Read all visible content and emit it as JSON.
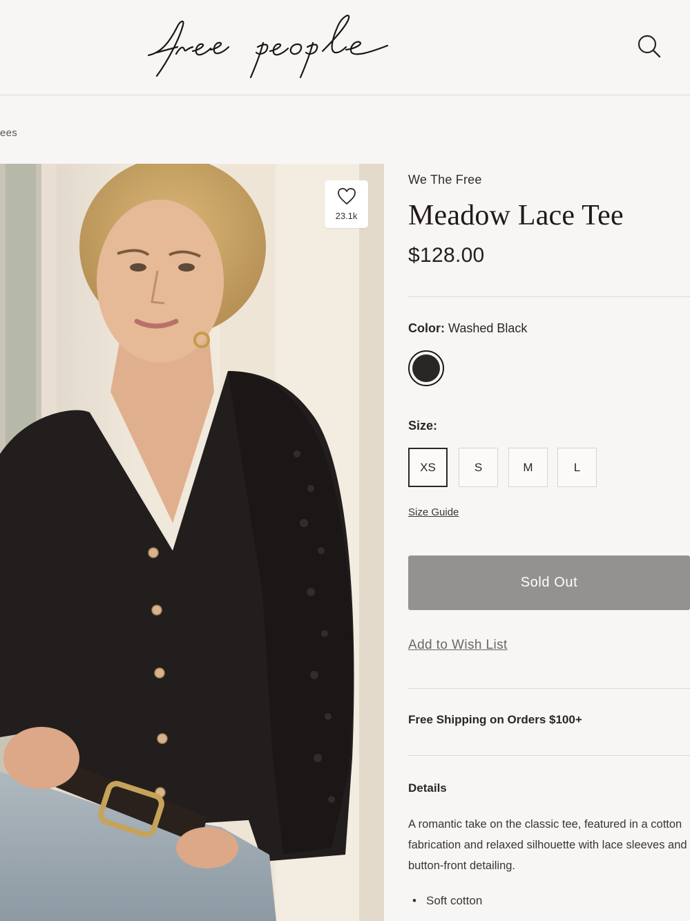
{
  "header": {
    "logo_text": "free people",
    "search_icon": "search-icon"
  },
  "breadcrumb": {
    "label": "ees"
  },
  "image": {
    "favorite_icon": "heart-icon",
    "favorite_count": "23.1k"
  },
  "product": {
    "brand": "We The Free",
    "title": "Meadow Lace Tee",
    "price": "$128.00",
    "color_label": "Color:",
    "color_value": "Washed Black",
    "swatch_color": "#2a2624",
    "size_label": "Size:",
    "sizes": [
      "XS",
      "S",
      "M",
      "L"
    ],
    "selected_size": "XS",
    "size_guide": "Size Guide",
    "sold_out_label": "Sold Out",
    "sold_out_color": "#939290",
    "wishlist_label": "Add to Wish List",
    "shipping_text": "Free Shipping on Orders $100+",
    "details_heading": "Details",
    "description": "A romantic take on the classic tee, featured in a cotton fabrication and relaxed silhouette with lace sleeves and button-front detailing.",
    "bullets": [
      "Soft cotton"
    ]
  }
}
